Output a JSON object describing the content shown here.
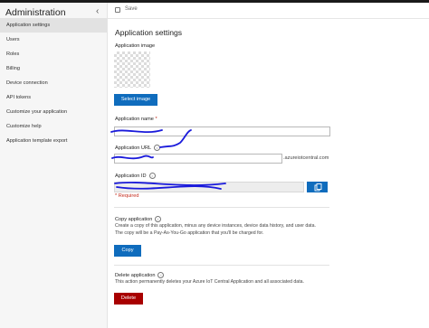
{
  "sidebar": {
    "title": "Administration",
    "items": [
      {
        "label": "Application settings",
        "active": true
      },
      {
        "label": "Users"
      },
      {
        "label": "Roles"
      },
      {
        "label": "Billing"
      },
      {
        "label": "Device connection"
      },
      {
        "label": "API tokens"
      },
      {
        "label": "Customize your application"
      },
      {
        "label": "Customize help"
      },
      {
        "label": "Application template export"
      }
    ]
  },
  "toolbar": {
    "save_label": "Save"
  },
  "main": {
    "title": "Application settings",
    "app_image_label": "Application image",
    "select_image_label": "Select image",
    "app_name_label": "Application name",
    "required_mark": "*",
    "app_url_label": "Application URL",
    "url_suffix": ".azureiotcentral.com",
    "app_id_label": "Application ID",
    "required_note": "* Required",
    "copy_section": {
      "title": "Copy application",
      "desc_line1": "Create a copy of this application, minus any device instances, device data history, and user data.",
      "desc_line2": "The copy will be a Pay-As-You-Go application that you'll be charged for.",
      "button_label": "Copy"
    },
    "delete_section": {
      "title": "Delete application",
      "desc": "This action permanently deletes your Azure IoT Central Application and all associated data.",
      "button_label": "Delete"
    }
  },
  "colors": {
    "accent": "#0f6cbd",
    "danger": "#a80000",
    "scribble": "#1a1adb"
  },
  "icons": [
    "save-icon",
    "chevron-left-icon",
    "info-icon",
    "copy-icon"
  ]
}
